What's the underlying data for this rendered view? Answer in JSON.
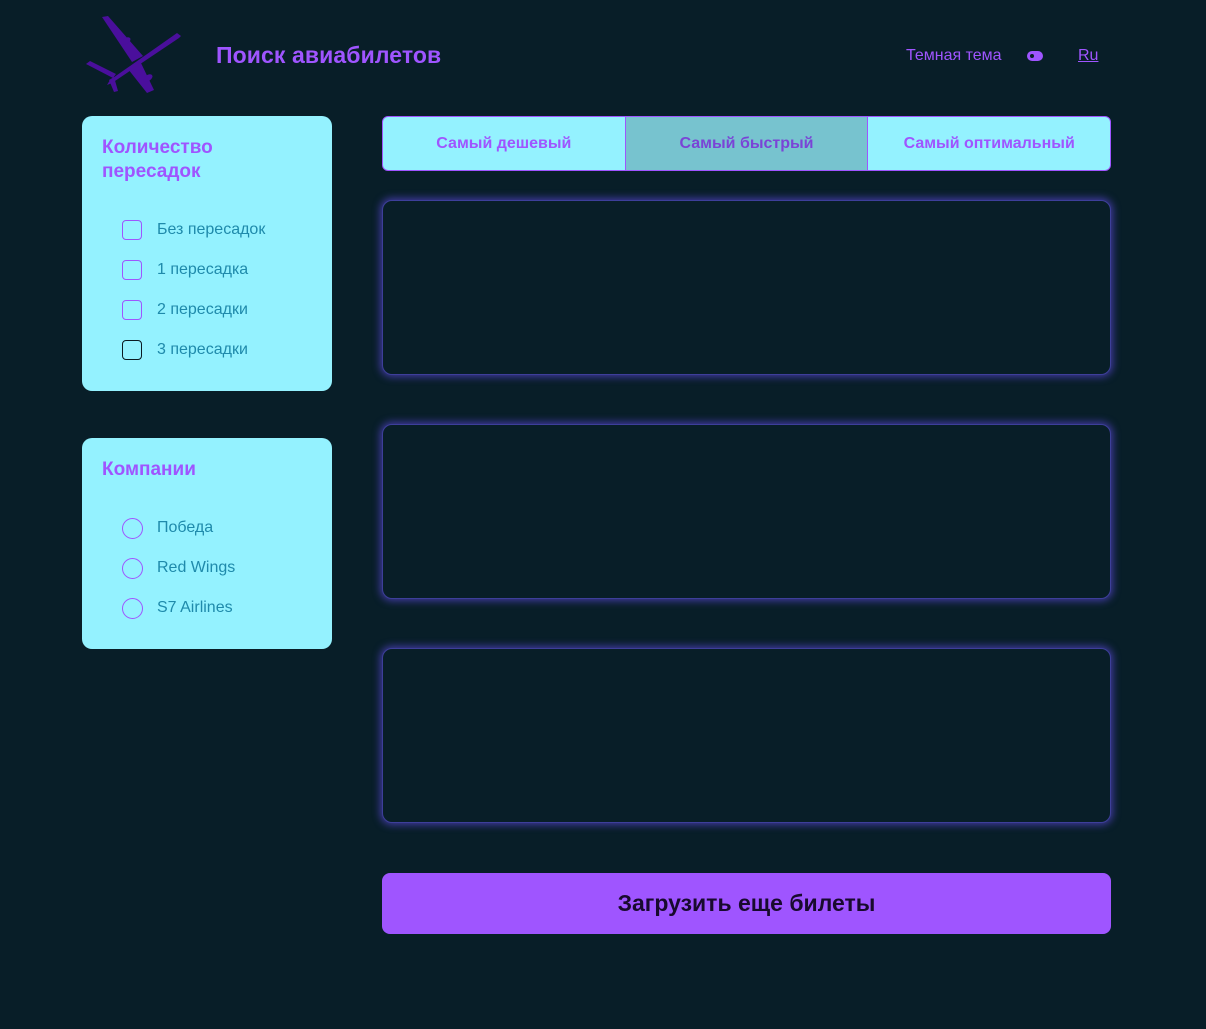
{
  "colors": {
    "background": "#081e28",
    "accent": "#9f55ff",
    "panel": "#94f2ff",
    "option_text": "#1f8aab",
    "active_tab": "#77c3cf",
    "plane_logo": "#4a0f9c"
  },
  "header": {
    "logo_icon": "airplane-icon",
    "title": "Поиск авиабилетов",
    "theme_label": "Темная тема",
    "theme_toggle_icon": "toggle-icon",
    "language": "Ru"
  },
  "filters": {
    "stops": {
      "title": "Количество пересадок",
      "options": [
        {
          "label": "Без пересадок",
          "checked": false
        },
        {
          "label": "1 пересадка",
          "checked": false
        },
        {
          "label": "2 пересадки",
          "checked": false
        },
        {
          "label": "3 пересадки",
          "checked": false
        }
      ]
    },
    "companies": {
      "title": "Компании",
      "options": [
        {
          "label": "Победа",
          "selected": false
        },
        {
          "label": "Red Wings",
          "selected": false
        },
        {
          "label": "S7 Airlines",
          "selected": false
        }
      ]
    }
  },
  "sort_tabs": [
    {
      "label": "Самый дешевый",
      "active": false
    },
    {
      "label": "Самый быстрый",
      "active": true
    },
    {
      "label": "Самый оптимальный",
      "active": false
    }
  ],
  "tickets": [
    {},
    {},
    {}
  ],
  "load_more_label": "Загрузить еще билеты"
}
